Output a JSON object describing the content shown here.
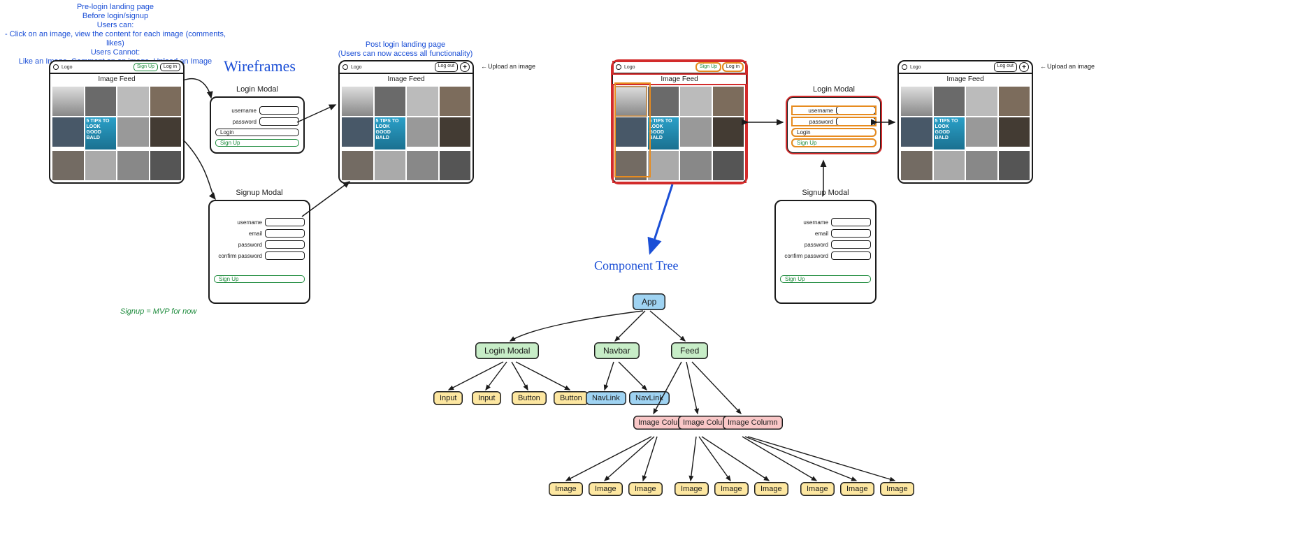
{
  "headings": {
    "wireframes": "Wireframes",
    "component_tree": "Component Tree"
  },
  "annotations": {
    "prelogin_title": "Pre-login landing page",
    "prelogin_sub": "Before login/signup",
    "users_can": "Users can:",
    "users_can_detail": "- Click on an image, view the content for each image (comments, likes)",
    "users_cannot": "Users Cannot:",
    "users_cannot_detail": "Like an Image, Comment on an image, Upload an Image",
    "postlogin_title": "Post login landing page",
    "postlogin_sub": "(Users can now access all functionality)",
    "upload_hint": "Upload an image",
    "signup_mvp": "Signup = MVP for now"
  },
  "window": {
    "logo": "Logo",
    "feed_title": "Image Feed",
    "tile_text": "5 TIPS TO LOOK GOOD BALD"
  },
  "buttons": {
    "signup": "Sign Up",
    "login": "Log in",
    "logout": "Log out",
    "login_action": "Login"
  },
  "modals": {
    "login_title": "Login Modal",
    "signup_title": "Signup Modal",
    "username": "username",
    "email": "email",
    "password": "password",
    "confirm_password": "confirm password"
  },
  "tree": {
    "app": "App",
    "login_modal": "Login Modal",
    "navbar": "Navbar",
    "feed": "Feed",
    "input": "Input",
    "button": "Button",
    "navlink": "NavLink",
    "image_column": "Image Column",
    "image": "Image"
  }
}
